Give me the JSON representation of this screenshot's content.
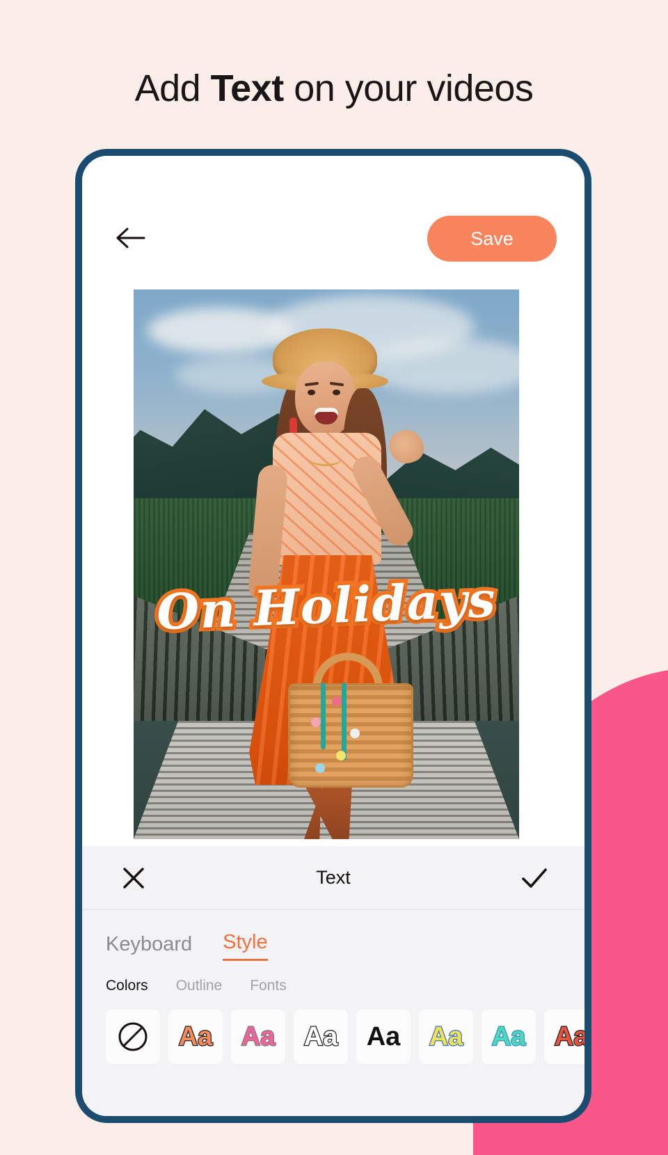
{
  "headline": {
    "pre": "Add ",
    "bold": "Text",
    "post": " on your videos"
  },
  "colors": {
    "accent": "#F7845C",
    "phone_frame": "#1B4C70",
    "page_bg": "#FBEEE8",
    "blob_pink": "#F9578A",
    "panel_bg": "#F3F2F5",
    "active_tab": "#F2703E"
  },
  "editor": {
    "back_icon": "arrow-left-icon",
    "save_label": "Save",
    "overlay_text": "On Holidays",
    "panel": {
      "close_icon": "close-icon",
      "title": "Text",
      "confirm_icon": "check-icon",
      "mode_tabs": [
        {
          "label": "Keyboard",
          "active": false
        },
        {
          "label": "Style",
          "active": true
        }
      ],
      "sub_tabs": [
        {
          "label": "Colors",
          "active": true
        },
        {
          "label": "Outline",
          "active": false
        },
        {
          "label": "Fonts",
          "active": false
        }
      ],
      "swatches": [
        {
          "name": "no-color",
          "glyph": "",
          "icon": "circle-slash-icon",
          "fill": "",
          "stroke": ""
        },
        {
          "name": "orange",
          "glyph": "Aa",
          "fill": "#F58A5B",
          "stroke": "#1A1A1A"
        },
        {
          "name": "pink",
          "glyph": "Aa",
          "fill": "#F2629A",
          "stroke": "#7A7A7A"
        },
        {
          "name": "white",
          "glyph": "Aa",
          "fill": "#FFFFFF",
          "stroke": "#1A1A1A"
        },
        {
          "name": "black",
          "glyph": "Aa",
          "fill": "#111111",
          "stroke": "#111111"
        },
        {
          "name": "yellow",
          "glyph": "Aa",
          "fill": "#F5E04F",
          "stroke": "#2F6FD0"
        },
        {
          "name": "teal",
          "glyph": "Aa",
          "fill": "#4FD8B6",
          "stroke": "#2F8FD0"
        },
        {
          "name": "red",
          "glyph": "Aa",
          "fill": "#E8553F",
          "stroke": "#1A1A1A"
        }
      ]
    }
  }
}
